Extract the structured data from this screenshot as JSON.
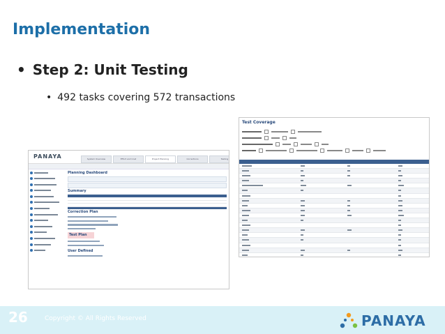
{
  "slide": {
    "title": "Implementation",
    "bullet_main": "Step 2: Unit Testing",
    "bullet_sub": "492 tasks covering 572 transactions",
    "bullet_glyph": "•",
    "page_number": "26",
    "copyright": "Copyright © All Rights Reserved",
    "logo_text": "PANAYA"
  },
  "left_screenshot": {
    "logo": "PANAYA",
    "tabs": [
      "System Overview",
      "Effort and Cost",
      "Project Planning",
      "Corrections",
      "Testing"
    ],
    "active_tab": "Project Planning",
    "dashboard_title": "Planning Dashboard",
    "sections": [
      "Summary",
      "Correction Plan",
      "Test Plan",
      "User Defined"
    ]
  },
  "right_screenshot": {
    "title": "Test Coverage"
  },
  "colors": {
    "title_blue": "#1d6fa8",
    "footer_bg": "#d9f1f7",
    "logo_blue": "#2d6da6",
    "logo_orange": "#f39a1e"
  }
}
